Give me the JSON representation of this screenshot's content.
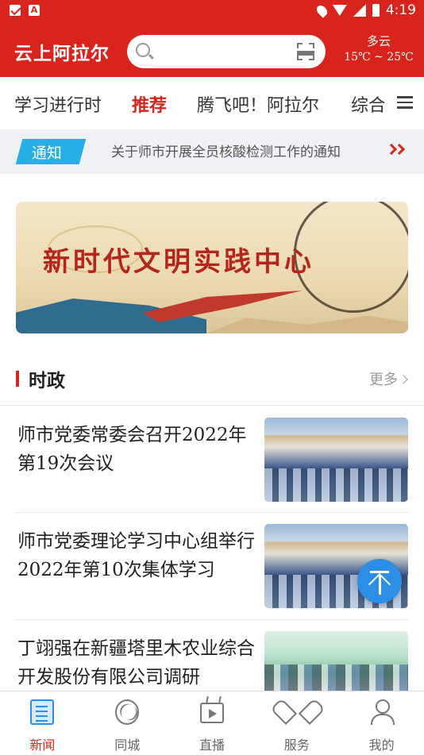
{
  "status_bar": {
    "time": "4:19"
  },
  "header": {
    "logo_text": "云上阿拉尔",
    "search_placeholder": "",
    "weather_condition": "多云",
    "weather_temp": "15℃ ~ 25℃"
  },
  "tabs": [
    {
      "label": "学习进行时",
      "active": false
    },
    {
      "label": "推荐",
      "active": true
    },
    {
      "label": "腾飞吧！阿拉尔",
      "active": false
    },
    {
      "label": "综合",
      "active": false
    }
  ],
  "notice": {
    "tag": "通知",
    "text": "关于师市开展全员核酸检测工作的通知"
  },
  "banner": {
    "title": "新时代文明实践中心"
  },
  "section": {
    "title": "时政",
    "more_label": "更多"
  },
  "news": [
    {
      "title": "师市党委常委会召开2022年第19次会议",
      "thumb": "meeting-photo"
    },
    {
      "title": "师市党委理论学习中心组举行2022年第10次集体学习",
      "thumb": "meeting-photo"
    },
    {
      "title": "丁翊强在新疆塔里木农业综合开发股份有限公司调研",
      "thumb": "visit-photo"
    }
  ],
  "bottom_nav": [
    {
      "label": "新闻",
      "icon": "news-icon",
      "active": true
    },
    {
      "label": "同城",
      "icon": "city-icon",
      "active": false
    },
    {
      "label": "直播",
      "icon": "live-tv-icon",
      "active": false
    },
    {
      "label": "服务",
      "icon": "heart-service-icon",
      "active": false
    },
    {
      "label": "我的",
      "icon": "user-icon",
      "active": false
    }
  ],
  "colors": {
    "brand_red": "#d8241c",
    "accent_blue": "#2b8fe6",
    "notice_blue": "#27b0e6"
  }
}
